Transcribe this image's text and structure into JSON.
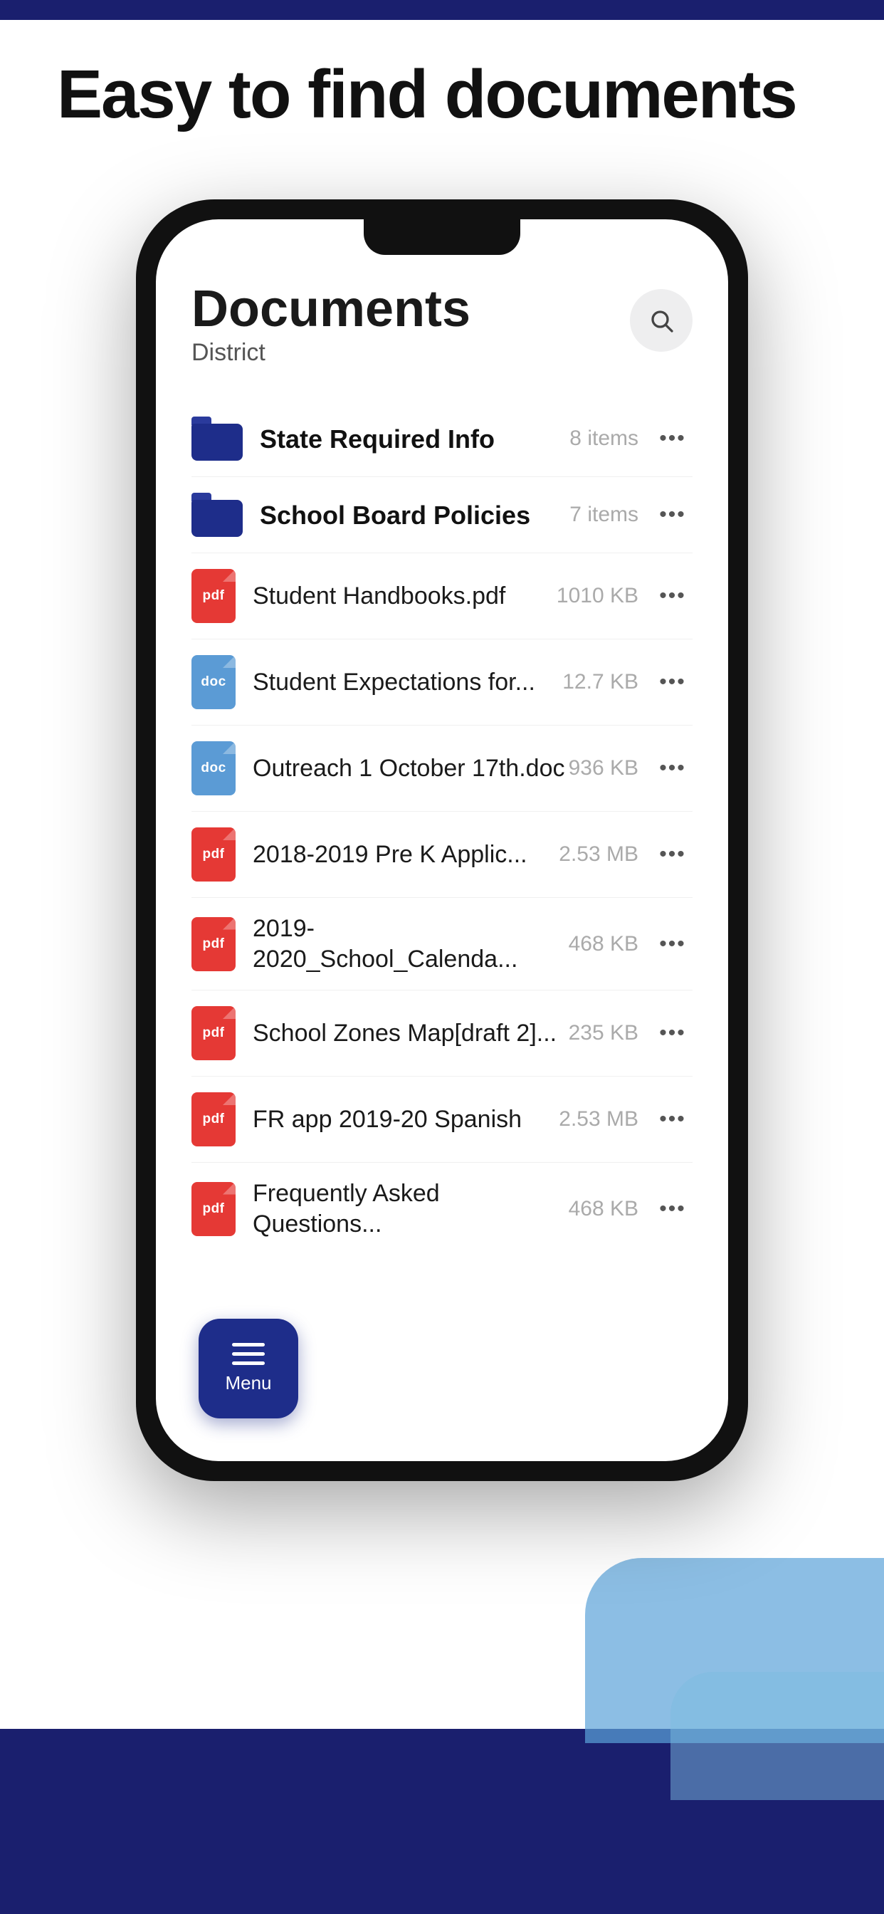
{
  "page": {
    "headline": "Easy to find documents",
    "top_bar_color": "#1a1f6e",
    "bottom_bar_color": "#1a1f6e"
  },
  "phone": {
    "screen": {
      "title": "Documents",
      "subtitle": "District",
      "search_label": "search"
    },
    "items": [
      {
        "id": "state-required",
        "type": "folder",
        "name": "State Required Info",
        "meta": "8 items"
      },
      {
        "id": "school-board",
        "type": "folder",
        "name": "School Board Policies",
        "meta": "7 items"
      },
      {
        "id": "student-handbooks",
        "type": "pdf",
        "name": "Student Handbooks.pdf",
        "meta": "1010 KB"
      },
      {
        "id": "student-expectations",
        "type": "doc",
        "name": "Student Expectations for...",
        "meta": "12.7 KB"
      },
      {
        "id": "outreach",
        "type": "doc",
        "name": "Outreach 1 October 17th.doc",
        "meta": "936 KB"
      },
      {
        "id": "pre-k-applic",
        "type": "pdf",
        "name": "2018-2019 Pre K Applic...",
        "meta": "2.53 MB"
      },
      {
        "id": "school-calendar",
        "type": "pdf",
        "name": "2019-2020_School_Calenda...",
        "meta": "468 KB"
      },
      {
        "id": "school-zones",
        "type": "pdf",
        "name": "School Zones Map[draft 2]...",
        "meta": "235 KB"
      },
      {
        "id": "fr-app",
        "type": "pdf",
        "name": "FR app 2019-20 Spanish",
        "meta": "2.53 MB"
      },
      {
        "id": "faq",
        "type": "pdf",
        "name": "Frequently Asked Questions...",
        "meta": "468 KB"
      }
    ],
    "menu": {
      "label": "Menu"
    }
  }
}
